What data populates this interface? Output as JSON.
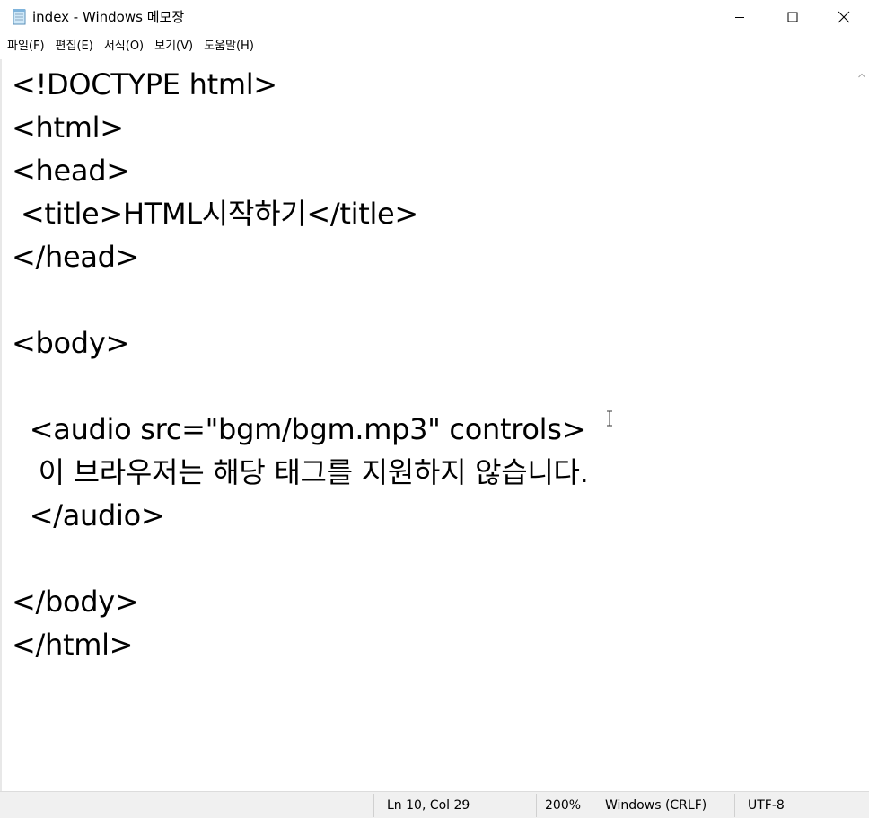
{
  "window": {
    "title": "index - Windows 메모장",
    "icon": "notepad-icon"
  },
  "menu": {
    "items": [
      {
        "label": "파일(F)"
      },
      {
        "label": "편집(E)"
      },
      {
        "label": "서식(O)"
      },
      {
        "label": "보기(V)"
      },
      {
        "label": "도움말(H)"
      }
    ]
  },
  "editor": {
    "lines": [
      "<!DOCTYPE html>",
      "<html>",
      "<head>",
      " <title>HTML시작하기</title>",
      "</head>",
      "",
      "<body>",
      "",
      "  <audio src=\"bgm/bgm.mp3\" controls>",
      "   이 브라우저는 해당 태그를 지원하지 않습니다.",
      "  </audio>",
      "",
      "</body>",
      "</html>"
    ]
  },
  "status": {
    "position": "Ln 10, Col 29",
    "zoom": "200%",
    "line_ending": "Windows (CRLF)",
    "encoding": "UTF-8"
  },
  "colors": {
    "statusbar_bg": "#f0f0f0",
    "text": "#000000",
    "background": "#ffffff"
  }
}
